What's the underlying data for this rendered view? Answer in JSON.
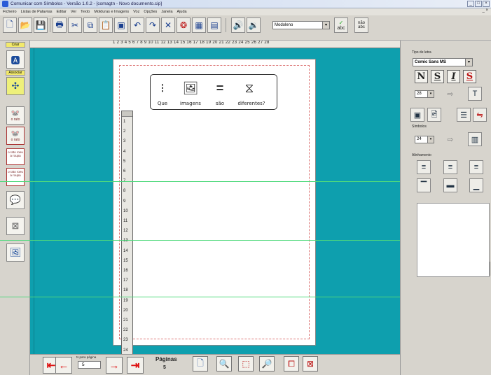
{
  "window": {
    "title": "Comunicar com Símbolos - Versão 1.0.2 - [comagtn - Novo documento.cip]",
    "controls": [
      "_",
      "□",
      "×"
    ]
  },
  "menu": {
    "items": [
      "Ficheiro",
      "Listas de Palavras",
      "Editar",
      "Ver",
      "Texto",
      "Molduras e Imagens",
      "Voz",
      "Opções",
      "Janela",
      "Ajuda"
    ],
    "mdi_controls": "_ ×"
  },
  "toolbar": {
    "font_dropdown_value": "Modoleno",
    "abc_label": "abc",
    "no_abc_label": "não abc"
  },
  "left_palette": {
    "tab_create": "Criar",
    "tab_associate": "Associar",
    "label_fr1": "o rato",
    "label_fr2": "o rato",
    "label_sentence_a": "o rato roeu a roupa",
    "label_sentence_b": "o rato roeu a roupa"
  },
  "ruler": {
    "numbers": "1 2 3 4 5 6 7 8 9 10 11 12 13 14 15 16 17 18 19 20 21 22 23 24 25 26 27 28"
  },
  "vertical_ruler": {
    "ticks": [
      "1",
      "2",
      "3",
      "4",
      "5",
      "6",
      "7",
      "8",
      "9",
      "10",
      "11",
      "12",
      "13",
      "14",
      "15",
      "16",
      "17",
      "18",
      "19",
      "20",
      "21",
      "22",
      "23",
      "24",
      "25"
    ]
  },
  "symbol_card": {
    "words": [
      "Que",
      "imagens",
      "são",
      "diferentes?"
    ],
    "symbols": [
      "question-dots",
      "images",
      "equals",
      "hourglass-different"
    ]
  },
  "right_panel": {
    "font_type_label": "Tipo de letra",
    "font_name": "Comic Sans MS",
    "format_buttons": [
      "N",
      "S",
      "I",
      "S"
    ],
    "font_size": "28",
    "symbols_label": "Símbolos",
    "symbol_size": "24",
    "alignment_label": "Alinhamento"
  },
  "bottom": {
    "pages_per_label": "N para página",
    "pages_per_value": "5",
    "pages_title": "Páginas",
    "pages_count": "5"
  },
  "colors": {
    "canvas_bg": "#0e9fae",
    "guide_line": "#4fd97c",
    "nav_arrow": "#dd1111"
  }
}
